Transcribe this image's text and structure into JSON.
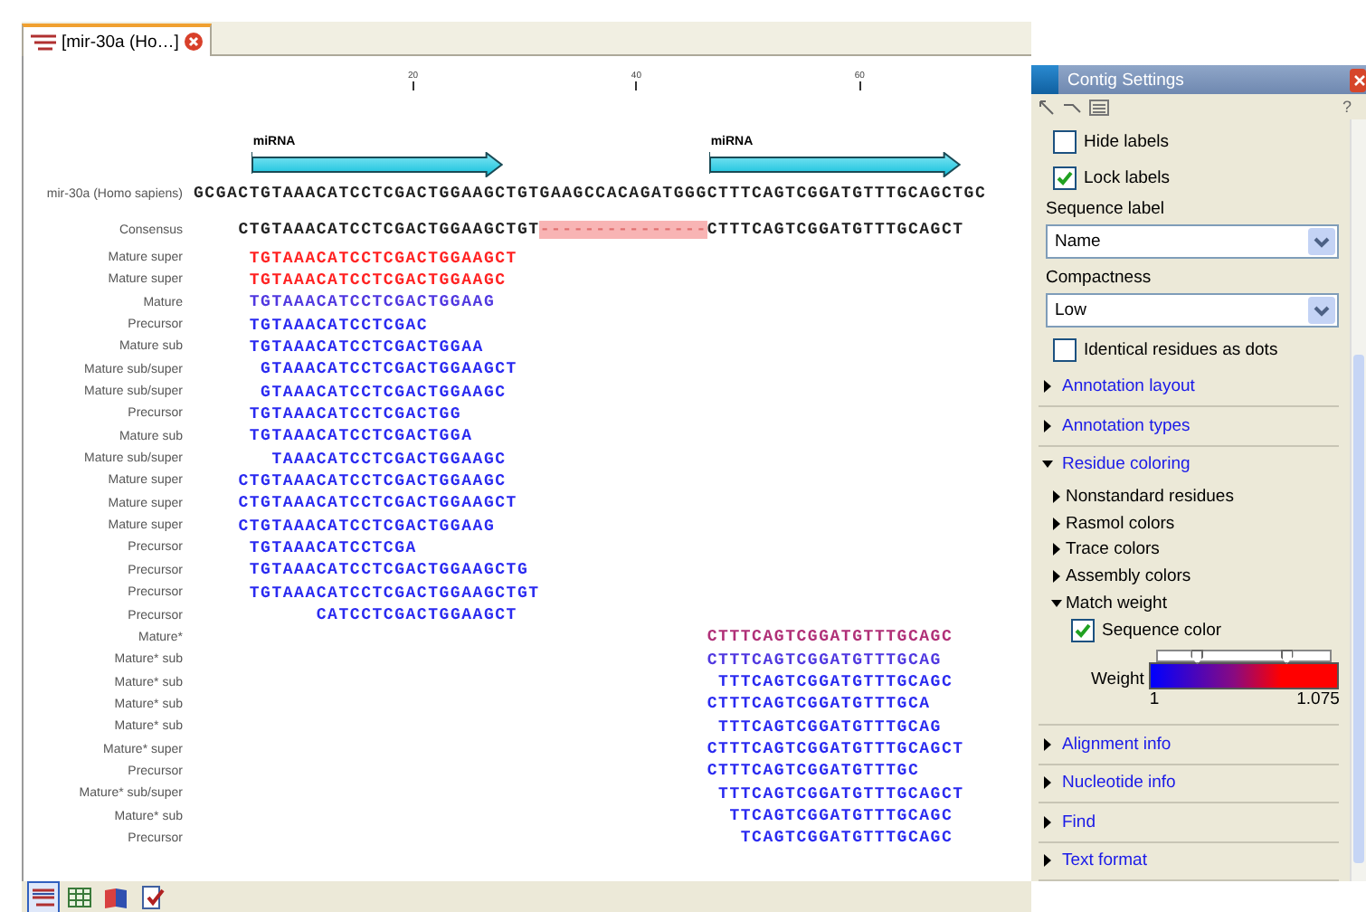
{
  "tab": {
    "title": "[mir-30a (Ho…]",
    "selected": true
  },
  "ruler": {
    "ticks": [
      "20",
      "40",
      "60"
    ]
  },
  "annotations": [
    {
      "label": "miRNA"
    },
    {
      "label": "miRNA"
    }
  ],
  "reference": {
    "name": "mir-30a (Homo sapiens)",
    "sequence": "GCGACTGTAAACATCCTCGACTGGAAGCTGTGAAGCCACAGATGGGCTTTCAGTCGGATGTTTGCAGCTGC"
  },
  "consensus": {
    "name": "Consensus",
    "sequence_start": "    CTGTAAACATCCTCGACTGGAAGCTGT",
    "gap": "---------------",
    "sequence_end": "CTTTCAGTCGGATGTTTGCAGCT"
  },
  "reads": [
    {
      "name": "Mature super",
      "sequence": "     TGTAAACATCCTCGACTGGAAGCT",
      "color": "#ff2222"
    },
    {
      "name": "Mature super",
      "sequence": "     TGTAAACATCCTCGACTGGAAGC",
      "color": "#ff2222"
    },
    {
      "name": "Mature",
      "sequence": "     TGTAAACATCCTCGACTGGAAG",
      "color": "#5038e0"
    },
    {
      "name": "Precursor",
      "sequence": "     TGTAAACATCCTCGAC",
      "color": "#2a2af0"
    },
    {
      "name": "Mature sub",
      "sequence": "     TGTAAACATCCTCGACTGGAA",
      "color": "#2a2af0"
    },
    {
      "name": "Mature sub/super",
      "sequence": "      GTAAACATCCTCGACTGGAAGCT",
      "color": "#2a2af0"
    },
    {
      "name": "Mature sub/super",
      "sequence": "      GTAAACATCCTCGACTGGAAGC",
      "color": "#2a2af0"
    },
    {
      "name": "Precursor",
      "sequence": "     TGTAAACATCCTCGACTGG",
      "color": "#2a2af0"
    },
    {
      "name": "Mature sub",
      "sequence": "     TGTAAACATCCTCGACTGGA",
      "color": "#2a2af0"
    },
    {
      "name": "Mature sub/super",
      "sequence": "       TAAACATCCTCGACTGGAAGC",
      "color": "#2a2af0"
    },
    {
      "name": "Mature super",
      "sequence": "    CTGTAAACATCCTCGACTGGAAGC",
      "color": "#2a2af0"
    },
    {
      "name": "Mature super",
      "sequence": "    CTGTAAACATCCTCGACTGGAAGCT",
      "color": "#2a2af0"
    },
    {
      "name": "Mature super",
      "sequence": "    CTGTAAACATCCTCGACTGGAAG",
      "color": "#2a2af0"
    },
    {
      "name": "Precursor",
      "sequence": "     TGTAAACATCCTCGA",
      "color": "#2a2af0"
    },
    {
      "name": "Precursor",
      "sequence": "     TGTAAACATCCTCGACTGGAAGCTG",
      "color": "#2a2af0"
    },
    {
      "name": "Precursor",
      "sequence": "     TGTAAACATCCTCGACTGGAAGCTGT",
      "color": "#2a2af0"
    },
    {
      "name": "Precursor",
      "sequence": "           CATCCTCGACTGGAAGCT",
      "color": "#2a2af0"
    },
    {
      "name": "Mature*",
      "sequence": "                                              CTTTCAGTCGGATGTTTGCAGC",
      "color": "#b03078"
    },
    {
      "name": "Mature* sub",
      "sequence": "                                              CTTTCAGTCGGATGTTTGCAG",
      "color": "#5038e0"
    },
    {
      "name": "Mature* sub",
      "sequence": "                                               TTTCAGTCGGATGTTTGCAGC",
      "color": "#2a2af0"
    },
    {
      "name": "Mature* sub",
      "sequence": "                                              CTTTCAGTCGGATGTTTGCA",
      "color": "#2a2af0"
    },
    {
      "name": "Mature* sub",
      "sequence": "                                               TTTCAGTCGGATGTTTGCAG",
      "color": "#2a2af0"
    },
    {
      "name": "Mature* super",
      "sequence": "                                              CTTTCAGTCGGATGTTTGCAGCT",
      "color": "#2a2af0"
    },
    {
      "name": "Precursor",
      "sequence": "                                              CTTTCAGTCGGATGTTTGC",
      "color": "#2a2af0"
    },
    {
      "name": "Mature* sub/super",
      "sequence": "                                               TTTCAGTCGGATGTTTGCAGCT",
      "color": "#2a2af0"
    },
    {
      "name": "Mature* sub",
      "sequence": "                                                TTCAGTCGGATGTTTGCAGC",
      "color": "#2a2af0"
    },
    {
      "name": "Precursor",
      "sequence": "                                                 TCAGTCGGATGTTTGCAGC",
      "color": "#2a2af0"
    }
  ],
  "view_buttons": [
    {
      "selected": true
    },
    {
      "selected": false
    },
    {
      "selected": false
    },
    {
      "selected": false
    }
  ],
  "settings_panel": {
    "title": "Contig Settings",
    "help": "?",
    "items": [
      {
        "kind": "checkbox",
        "label": "Hide labels",
        "checked": false
      },
      {
        "kind": "checkbox",
        "label": "Lock labels",
        "checked": true
      },
      {
        "kind": "dropdown",
        "label": "Sequence label",
        "value": "Name"
      },
      {
        "kind": "dropdown",
        "label": "Compactness",
        "value": "Low"
      },
      {
        "kind": "checkbox",
        "label": "Identical residues as dots",
        "checked": false
      },
      {
        "kind": "section",
        "label": "Annotation layout",
        "expanded": false
      },
      {
        "kind": "section",
        "label": "Annotation types",
        "expanded": false
      },
      {
        "kind": "section",
        "label": "Residue coloring",
        "expanded": true,
        "children": [
          {
            "kind": "subsection",
            "label": "Nonstandard residues",
            "expanded": false
          },
          {
            "kind": "subsection",
            "label": "Rasmol colors",
            "expanded": false
          },
          {
            "kind": "subsection",
            "label": "Trace colors",
            "expanded": false
          },
          {
            "kind": "subsection",
            "label": "Assembly colors",
            "expanded": false
          },
          {
            "kind": "subsection",
            "label": "Match weight",
            "expanded": true,
            "children": [
              {
                "kind": "checkbox",
                "label": "Sequence color",
                "checked": true
              },
              {
                "kind": "weight",
                "label": "Weight",
                "min": "1",
                "max": "1.075",
                "low": {
                  "level": 0.23
                },
                "high": {
                  "level": 0.75
                }
              }
            ]
          }
        ]
      },
      {
        "kind": "section",
        "label": "Alignment info",
        "expanded": false
      },
      {
        "kind": "section",
        "label": "Nucleotide info",
        "expanded": false
      },
      {
        "kind": "section",
        "label": "Find",
        "expanded": false
      },
      {
        "kind": "section",
        "label": "Text format",
        "expanded": false
      }
    ]
  }
}
